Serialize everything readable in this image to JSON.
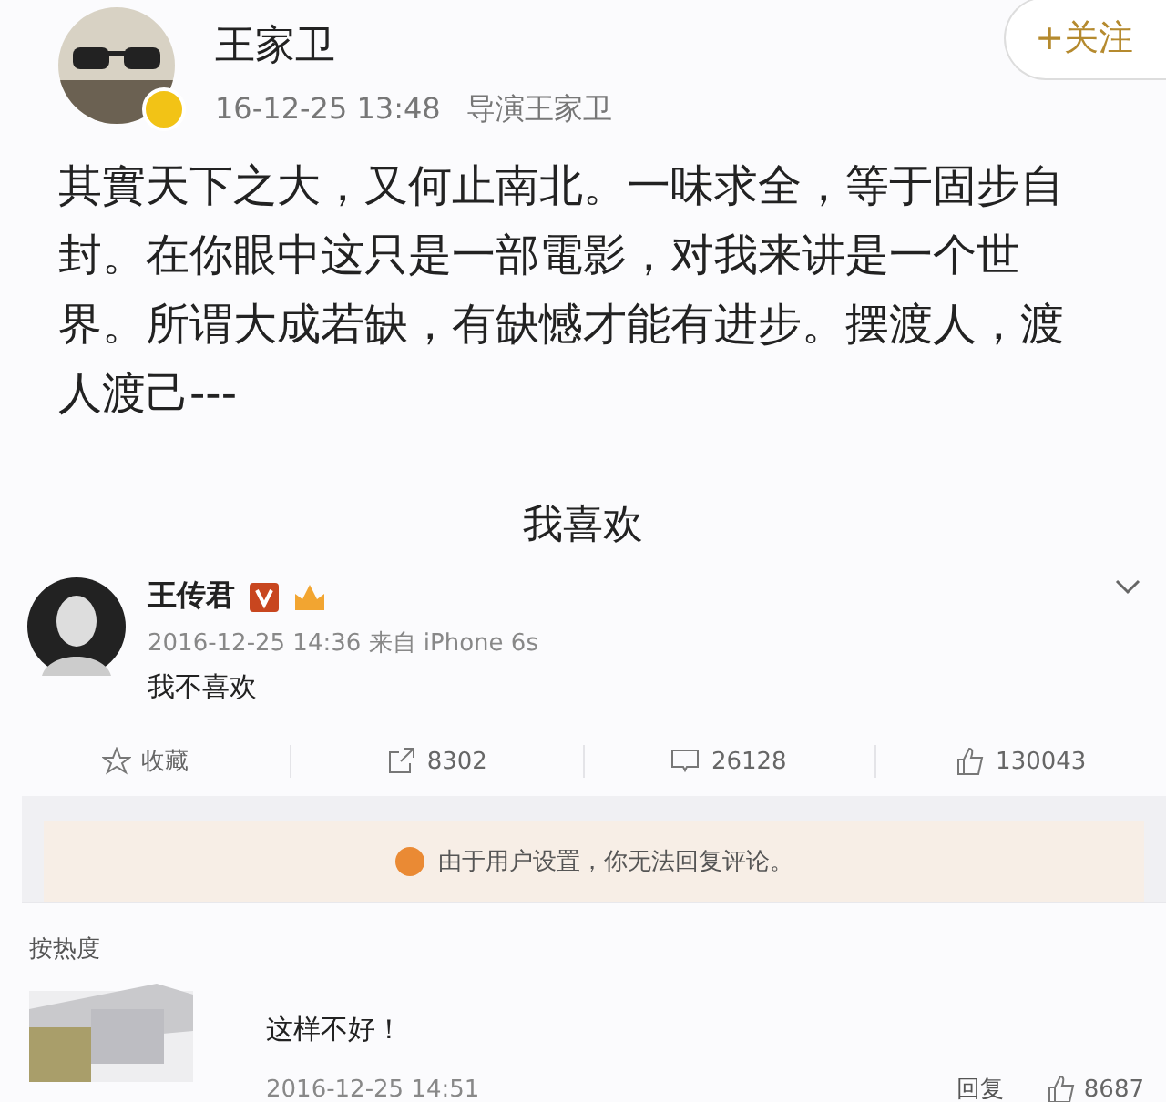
{
  "post": {
    "author": "王家卫",
    "verified": true,
    "time": "16-12-25 13:48",
    "source": "导演王家卫",
    "follow": "+关注",
    "text": "其實天下之大，又何止南北。一味求全，等于固步自封。在你眼中这只是一部電影，对我来讲是一个世界。所谓大成若缺，有缺憾才能有进步。摆渡人，渡人渡己---",
    "caption": "我喜欢"
  },
  "reply": {
    "author": "王传君",
    "time": "2016-12-25 14:36 来自 iPhone 6s",
    "text": "我不喜欢"
  },
  "actions": [
    {
      "kind": "star",
      "label": "收藏"
    },
    {
      "kind": "share",
      "label": "8302"
    },
    {
      "kind": "comment",
      "label": "26128"
    },
    {
      "kind": "like",
      "label": "130043"
    }
  ],
  "notice": "由于用户设置，你无法回复评论。",
  "sort": "按热度",
  "comments": [
    {
      "text": "这样不好！",
      "time": "2016-12-25 14:51",
      "reply": "回复",
      "likes": "8687"
    }
  ]
}
